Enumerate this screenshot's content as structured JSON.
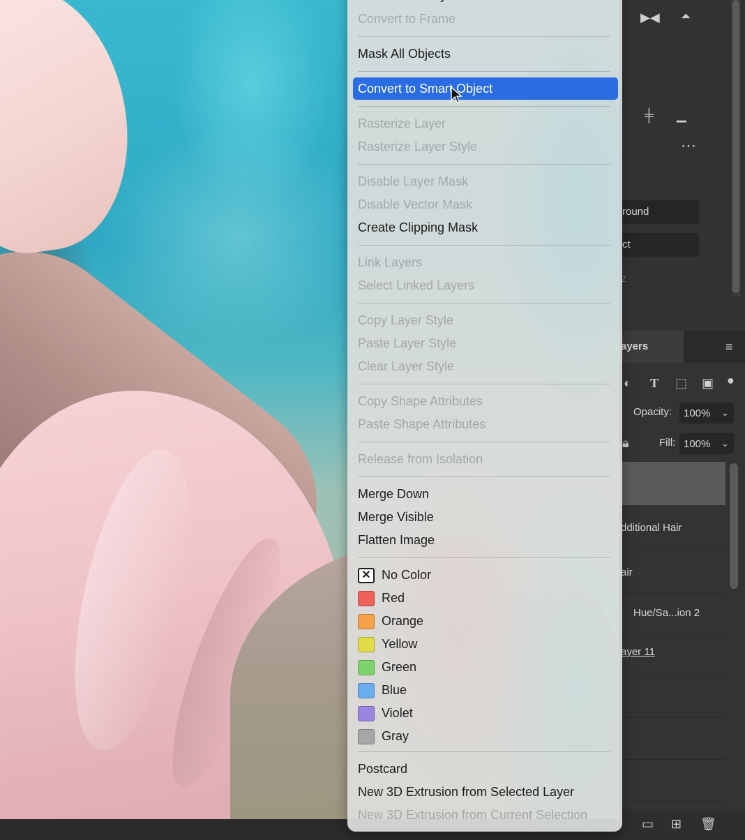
{
  "menu": {
    "partial_top_label": "Frame from Layers...",
    "items": {
      "convert_to_frame": "Convert to Frame",
      "mask_all_objects": "Mask All Objects",
      "convert_to_smart_object": "Convert to Smart Object",
      "rasterize_layer": "Rasterize Layer",
      "rasterize_layer_style": "Rasterize Layer Style",
      "disable_layer_mask": "Disable Layer Mask",
      "disable_vector_mask": "Disable Vector Mask",
      "create_clipping_mask": "Create Clipping Mask",
      "link_layers": "Link Layers",
      "select_linked_layers": "Select Linked Layers",
      "copy_layer_style": "Copy Layer Style",
      "paste_layer_style": "Paste Layer Style",
      "clear_layer_style": "Clear Layer Style",
      "copy_shape_attributes": "Copy Shape Attributes",
      "paste_shape_attributes": "Paste Shape Attributes",
      "release_from_isolation": "Release from Isolation",
      "merge_down": "Merge Down",
      "merge_visible": "Merge Visible",
      "flatten_image": "Flatten Image",
      "postcard": "Postcard",
      "new_3d_extrusion_selected_layer": "New 3D Extrusion from Selected Layer",
      "new_3d_extrusion_current_selection": "New 3D Extrusion from Current Selection"
    },
    "colors": [
      {
        "label": "No Color",
        "hex": "#ffffff"
      },
      {
        "label": "Red",
        "hex": "#f0605a"
      },
      {
        "label": "Orange",
        "hex": "#f5a04a"
      },
      {
        "label": "Yellow",
        "hex": "#e2dc4a"
      },
      {
        "label": "Green",
        "hex": "#7ed46a"
      },
      {
        "label": "Blue",
        "hex": "#6aaef0"
      },
      {
        "label": "Violet",
        "hex": "#9a86e0"
      },
      {
        "label": "Gray",
        "hex": "#a6a6a6"
      }
    ],
    "highlight_color": "#2a6de2"
  },
  "properties_panel": {
    "background_field": "round",
    "object_field": "ct",
    "small_label": "2"
  },
  "layers_panel": {
    "tab_label": "ayers",
    "opacity_label": "Opacity:",
    "opacity_value": "100%",
    "fill_label": "Fill:",
    "fill_value": "100%",
    "layers": [
      {
        "name": "dditional Hair"
      },
      {
        "name": "air"
      },
      {
        "name": "Hue/Sa...ion 2"
      },
      {
        "name": "ayer 11"
      }
    ]
  }
}
